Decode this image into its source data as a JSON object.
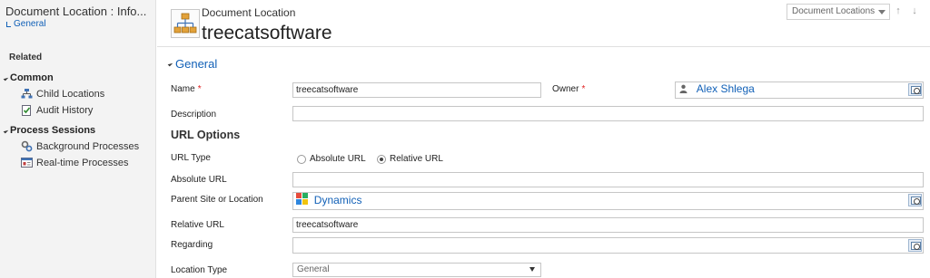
{
  "nav": {
    "title": "Document Location : Info...",
    "form_name": "General",
    "related_label": "Related",
    "groups": [
      {
        "label": "Common",
        "items": [
          "Child Locations",
          "Audit History"
        ]
      },
      {
        "label": "Process Sessions",
        "items": [
          "Background Processes",
          "Real-time Processes"
        ]
      }
    ]
  },
  "header": {
    "entity_type": "Document Location",
    "record_name": "treecatsoftware",
    "form_selector": "Document Locations",
    "up_arrow": "↑",
    "down_arrow": "↓"
  },
  "section": {
    "title": "General",
    "url_options_title": "URL Options"
  },
  "fields": {
    "name": {
      "label": "Name",
      "required": "*",
      "value": "treecatsoftware"
    },
    "owner": {
      "label": "Owner",
      "required": "*",
      "value": "Alex Shlega"
    },
    "description": {
      "label": "Description",
      "value": ""
    },
    "url_type": {
      "label": "URL Type",
      "options": [
        "Absolute URL",
        "Relative URL"
      ],
      "selected": "Relative URL"
    },
    "absolute_url": {
      "label": "Absolute URL",
      "value": ""
    },
    "parent_site": {
      "label": "Parent Site or Location",
      "value": "Dynamics"
    },
    "relative_url": {
      "label": "Relative URL",
      "value": "treecatsoftware"
    },
    "regarding": {
      "label": "Regarding",
      "value": ""
    },
    "location_type": {
      "label": "Location Type",
      "value": "General"
    }
  },
  "colors": {
    "link": "#1160b7",
    "required": "#e02020",
    "nav_bg": "#f3f3f3"
  }
}
